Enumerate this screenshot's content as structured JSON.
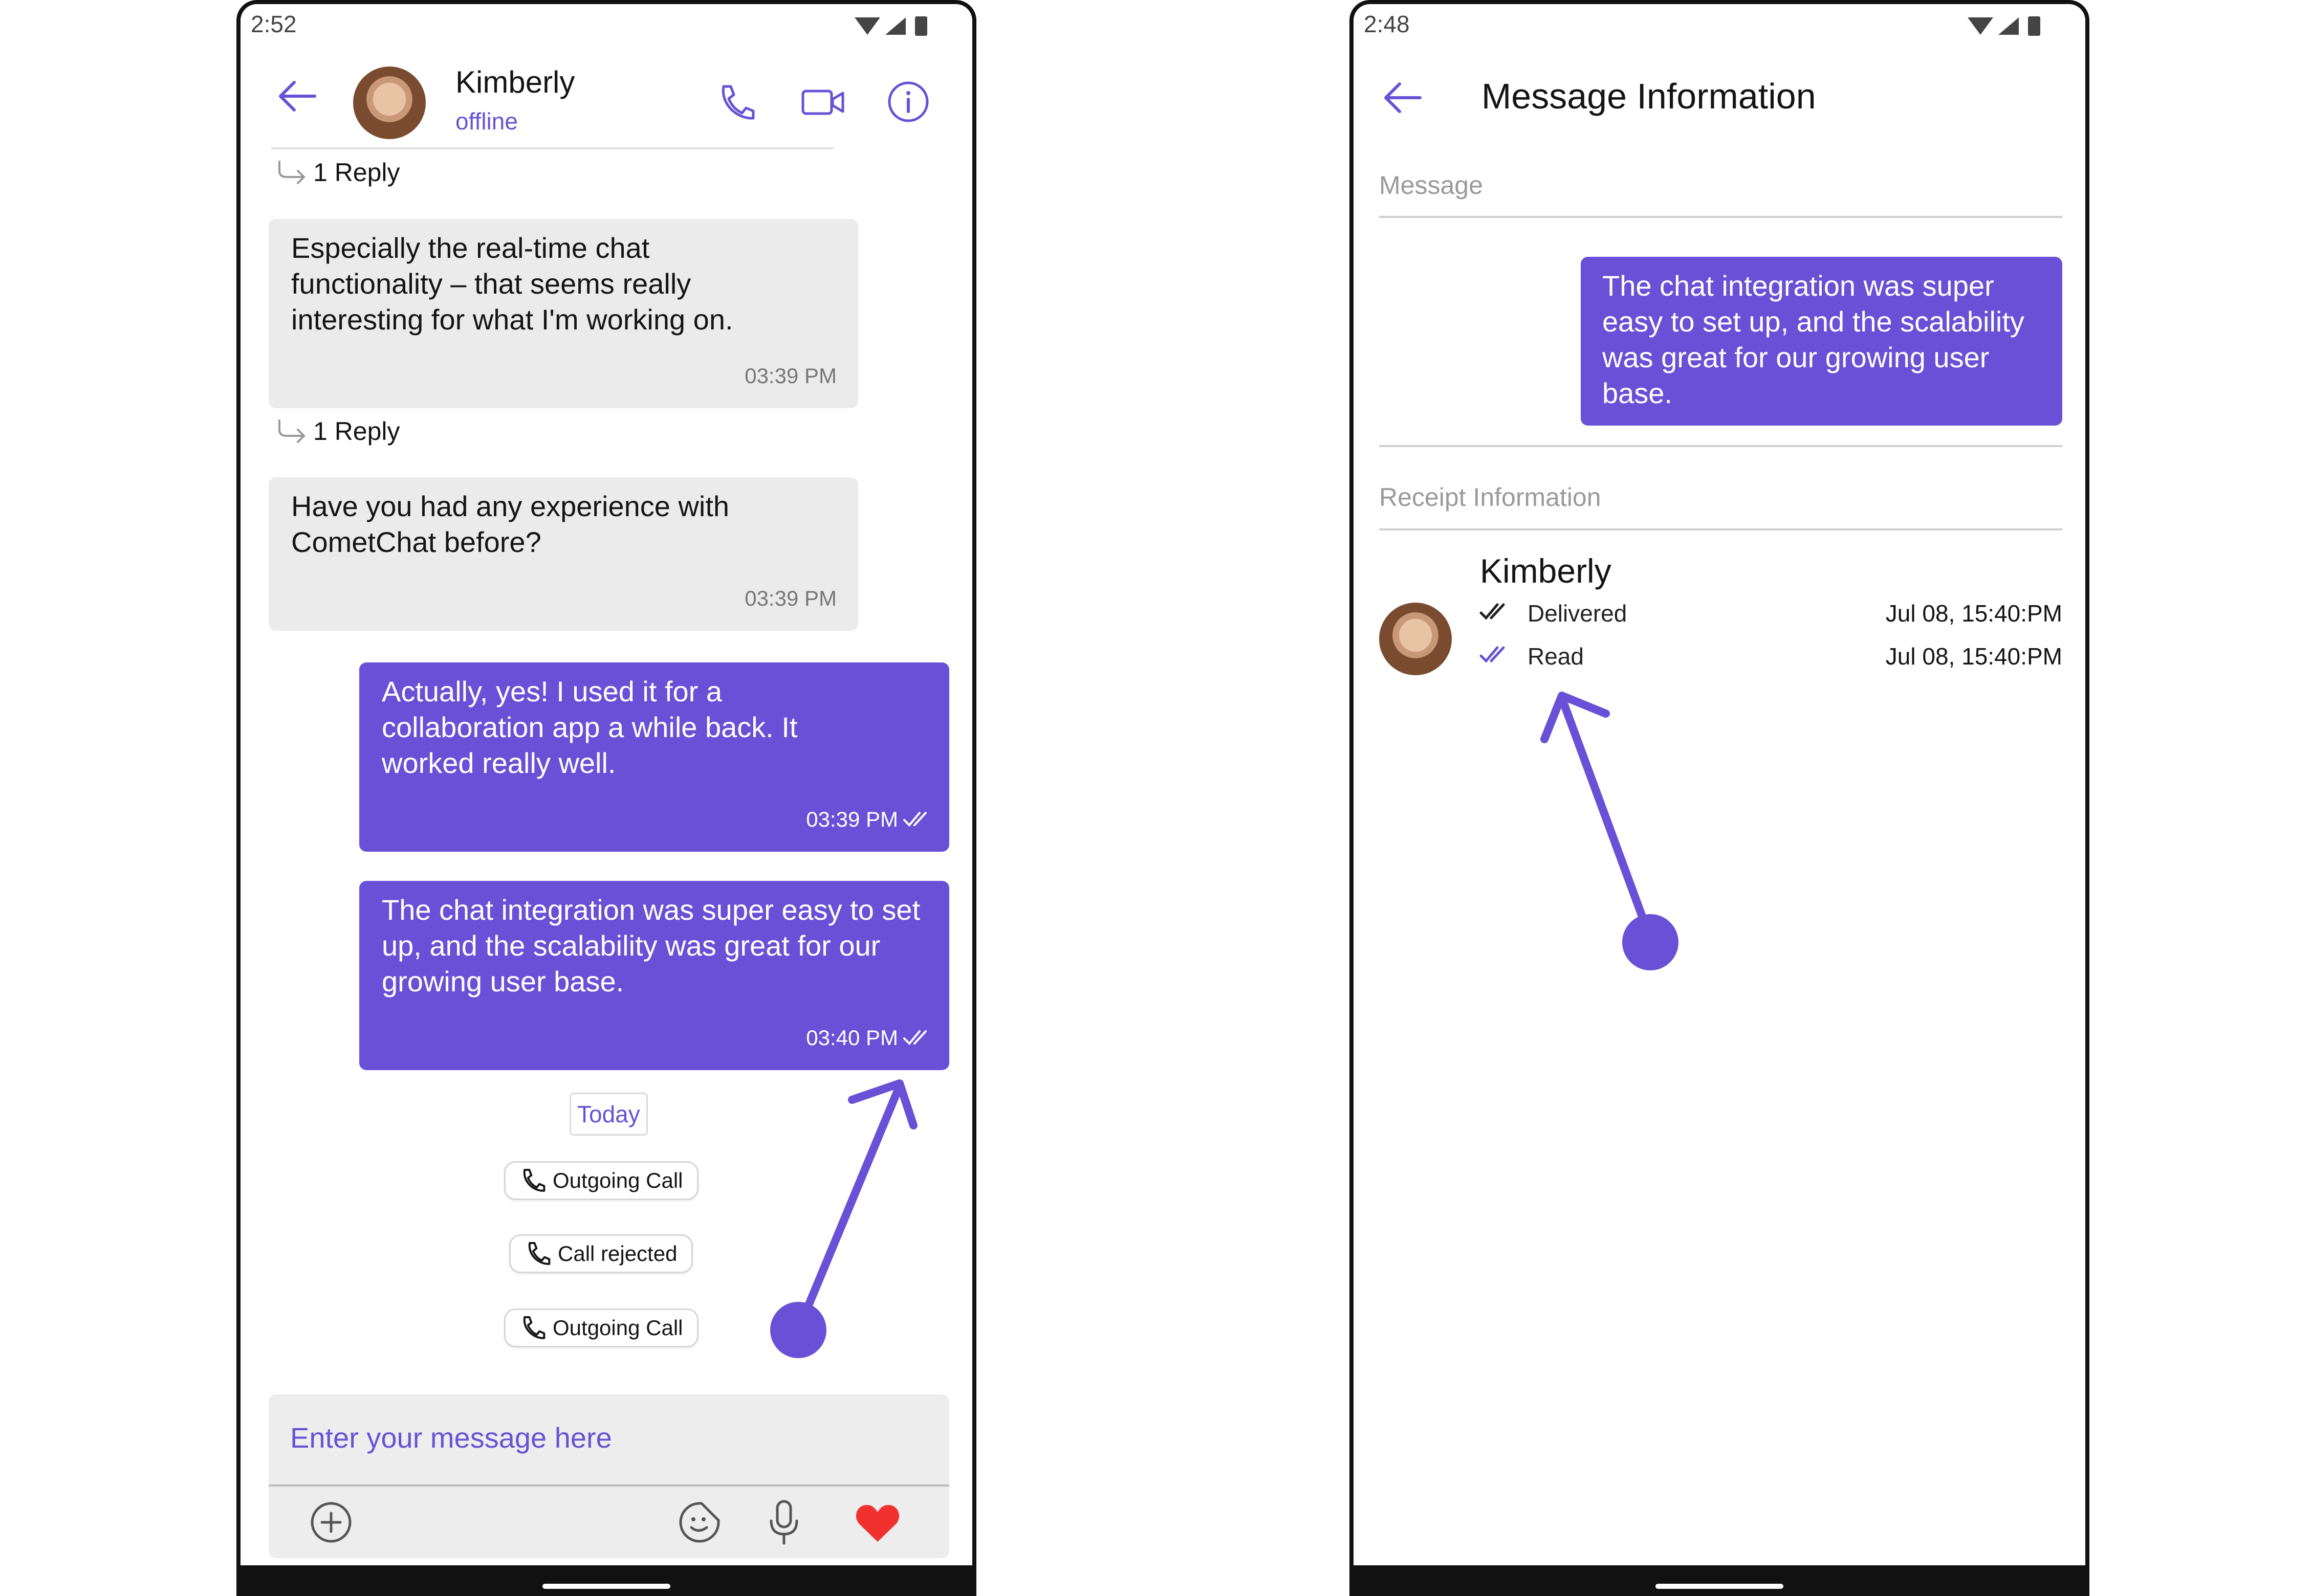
{
  "left": {
    "status": {
      "time": "2:52"
    },
    "header": {
      "name": "Kimberly",
      "status": "offline"
    },
    "thread_reply_1": "1 Reply",
    "thread_reply_2": "1 Reply",
    "messages": [
      {
        "text": "Especially the real-time chat functionality – that seems really interesting for what I'm working on.",
        "time": "03:39 PM",
        "direction": "incoming"
      },
      {
        "text": "Have you had any experience with CometChat before?",
        "time": "03:39 PM",
        "direction": "incoming"
      },
      {
        "text": "Actually, yes!  I used it for a collaboration app a while back.  It worked really well.",
        "time": "03:39 PM",
        "direction": "outgoing"
      },
      {
        "text": "The chat integration was super easy to set up, and the scalability was great for our growing user base.",
        "time": "03:40 PM",
        "direction": "outgoing"
      }
    ],
    "date_separator": "Today",
    "call_pills": [
      "Outgoing Call",
      "Call rejected",
      "Outgoing Call"
    ],
    "composer": {
      "placeholder": "Enter your message here"
    }
  },
  "right": {
    "status": {
      "time": "2:48"
    },
    "title": "Message Information",
    "message_label": "Message",
    "message_text": "The chat integration was super easy to set up, and the scalability was great for our growing user base.",
    "receipt_label": "Receipt Information",
    "receipt": {
      "name": "Kimberly",
      "delivered_label": "Delivered",
      "delivered_time": "Jul 08, 15:40:PM",
      "read_label": "Read",
      "read_time": "Jul 08, 15:40:PM"
    }
  },
  "colors": {
    "accent": "#6851D6",
    "bubble_in": "#EBEBEB",
    "heart": "#F0312E"
  },
  "icons": [
    "back-arrow-icon",
    "phone-icon",
    "video-icon",
    "info-icon",
    "reply-arrow-icon",
    "double-check-icon",
    "add-icon",
    "sticker-icon",
    "microphone-icon",
    "heart-icon",
    "wifi-icon",
    "signal-icon",
    "battery-icon"
  ]
}
